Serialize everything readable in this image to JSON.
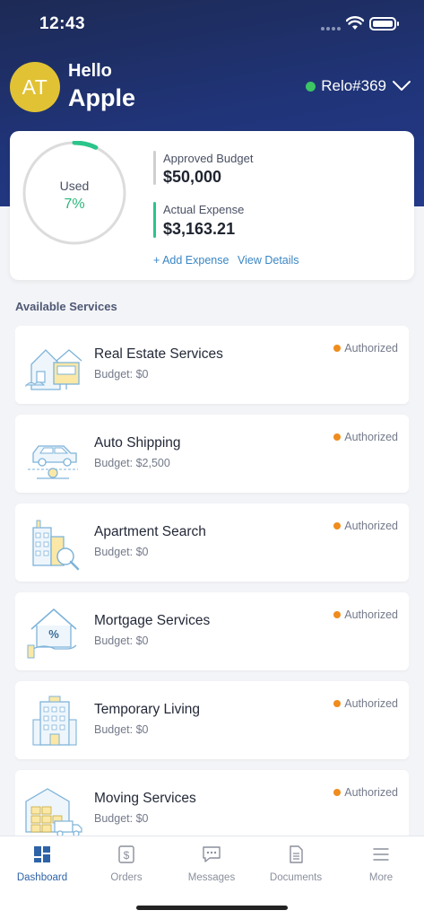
{
  "status_bar": {
    "time": "12:43"
  },
  "header": {
    "avatar_initials": "AT",
    "greeting": "Hello",
    "user_name": "Apple",
    "relocation": "Relo#369"
  },
  "budget": {
    "used_label": "Used",
    "used_percent": "7%",
    "used_fraction": 0.07,
    "approved_label": "Approved Budget",
    "approved_value": "$50,000",
    "actual_label": "Actual Expense",
    "actual_value": "$3,163.21",
    "add_expense": "+ Add Expense",
    "view_details": "View Details"
  },
  "services_title": "Available Services",
  "services": [
    {
      "name": "Real Estate Services",
      "budget": "Budget: $0",
      "status": "Authorized",
      "icon": "house-sign-icon"
    },
    {
      "name": "Auto Shipping",
      "budget": "Budget: $2,500",
      "status": "Authorized",
      "icon": "car-shipping-icon"
    },
    {
      "name": "Apartment Search",
      "budget": "Budget: $0",
      "status": "Authorized",
      "icon": "apartment-search-icon"
    },
    {
      "name": "Mortgage Services",
      "budget": "Budget: $0",
      "status": "Authorized",
      "icon": "house-percent-icon"
    },
    {
      "name": "Temporary Living",
      "budget": "Budget: $0",
      "status": "Authorized",
      "icon": "building-icon"
    },
    {
      "name": "Moving Services",
      "budget": "Budget: $0",
      "status": "Authorized",
      "icon": "moving-truck-icon"
    }
  ],
  "nav": [
    {
      "label": "Dashboard",
      "icon": "dashboard-icon",
      "active": true
    },
    {
      "label": "Orders",
      "icon": "dollar-doc-icon",
      "active": false
    },
    {
      "label": "Messages",
      "icon": "chat-icon",
      "active": false
    },
    {
      "label": "Documents",
      "icon": "document-icon",
      "active": false
    },
    {
      "label": "More",
      "icon": "menu-icon",
      "active": false
    }
  ],
  "colors": {
    "header": "#203479",
    "accent_green": "#2bc48a",
    "link": "#3a86c4",
    "status_orange": "#ef8c1d",
    "nav_active": "#2e63a8"
  }
}
